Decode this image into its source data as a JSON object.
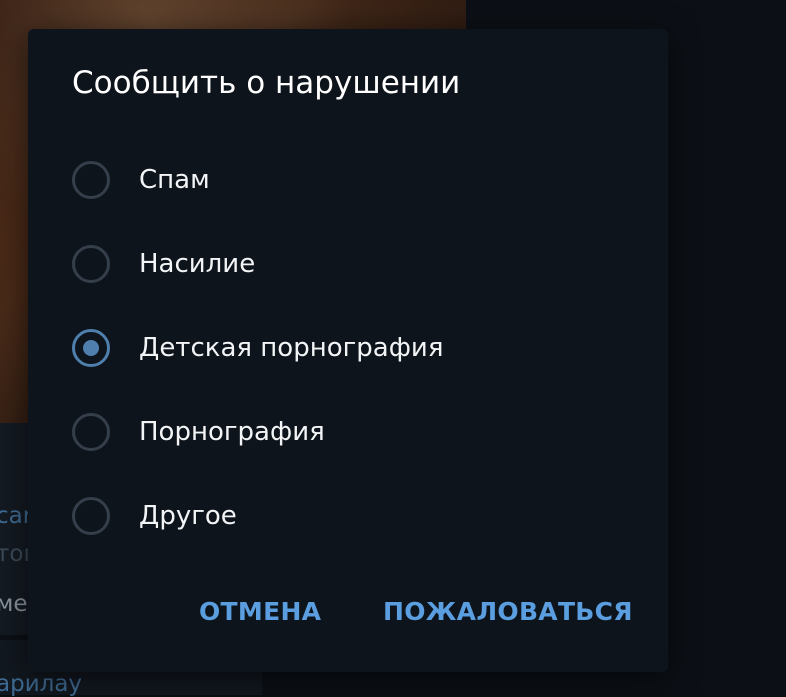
{
  "background": {
    "partial_lines": [
      "сar",
      "тог",
      "ме",
      "арилау"
    ]
  },
  "dialog": {
    "title": "Сообщить о нарушении",
    "options": [
      {
        "label": "Спам",
        "selected": false
      },
      {
        "label": "Насилие",
        "selected": false
      },
      {
        "label": "Детская порнография",
        "selected": true
      },
      {
        "label": "Порнография",
        "selected": false
      },
      {
        "label": "Другое",
        "selected": false
      }
    ],
    "cancel_label": "ОТМЕНА",
    "report_label": "ПОЖАЛОВАТЬСЯ"
  },
  "colors": {
    "dialog_bg": "#0e141b",
    "accent": "#5b9ee0",
    "radio_checked": "#4f7fad",
    "radio_unchecked": "#353f4b",
    "text": "#ffffff"
  }
}
